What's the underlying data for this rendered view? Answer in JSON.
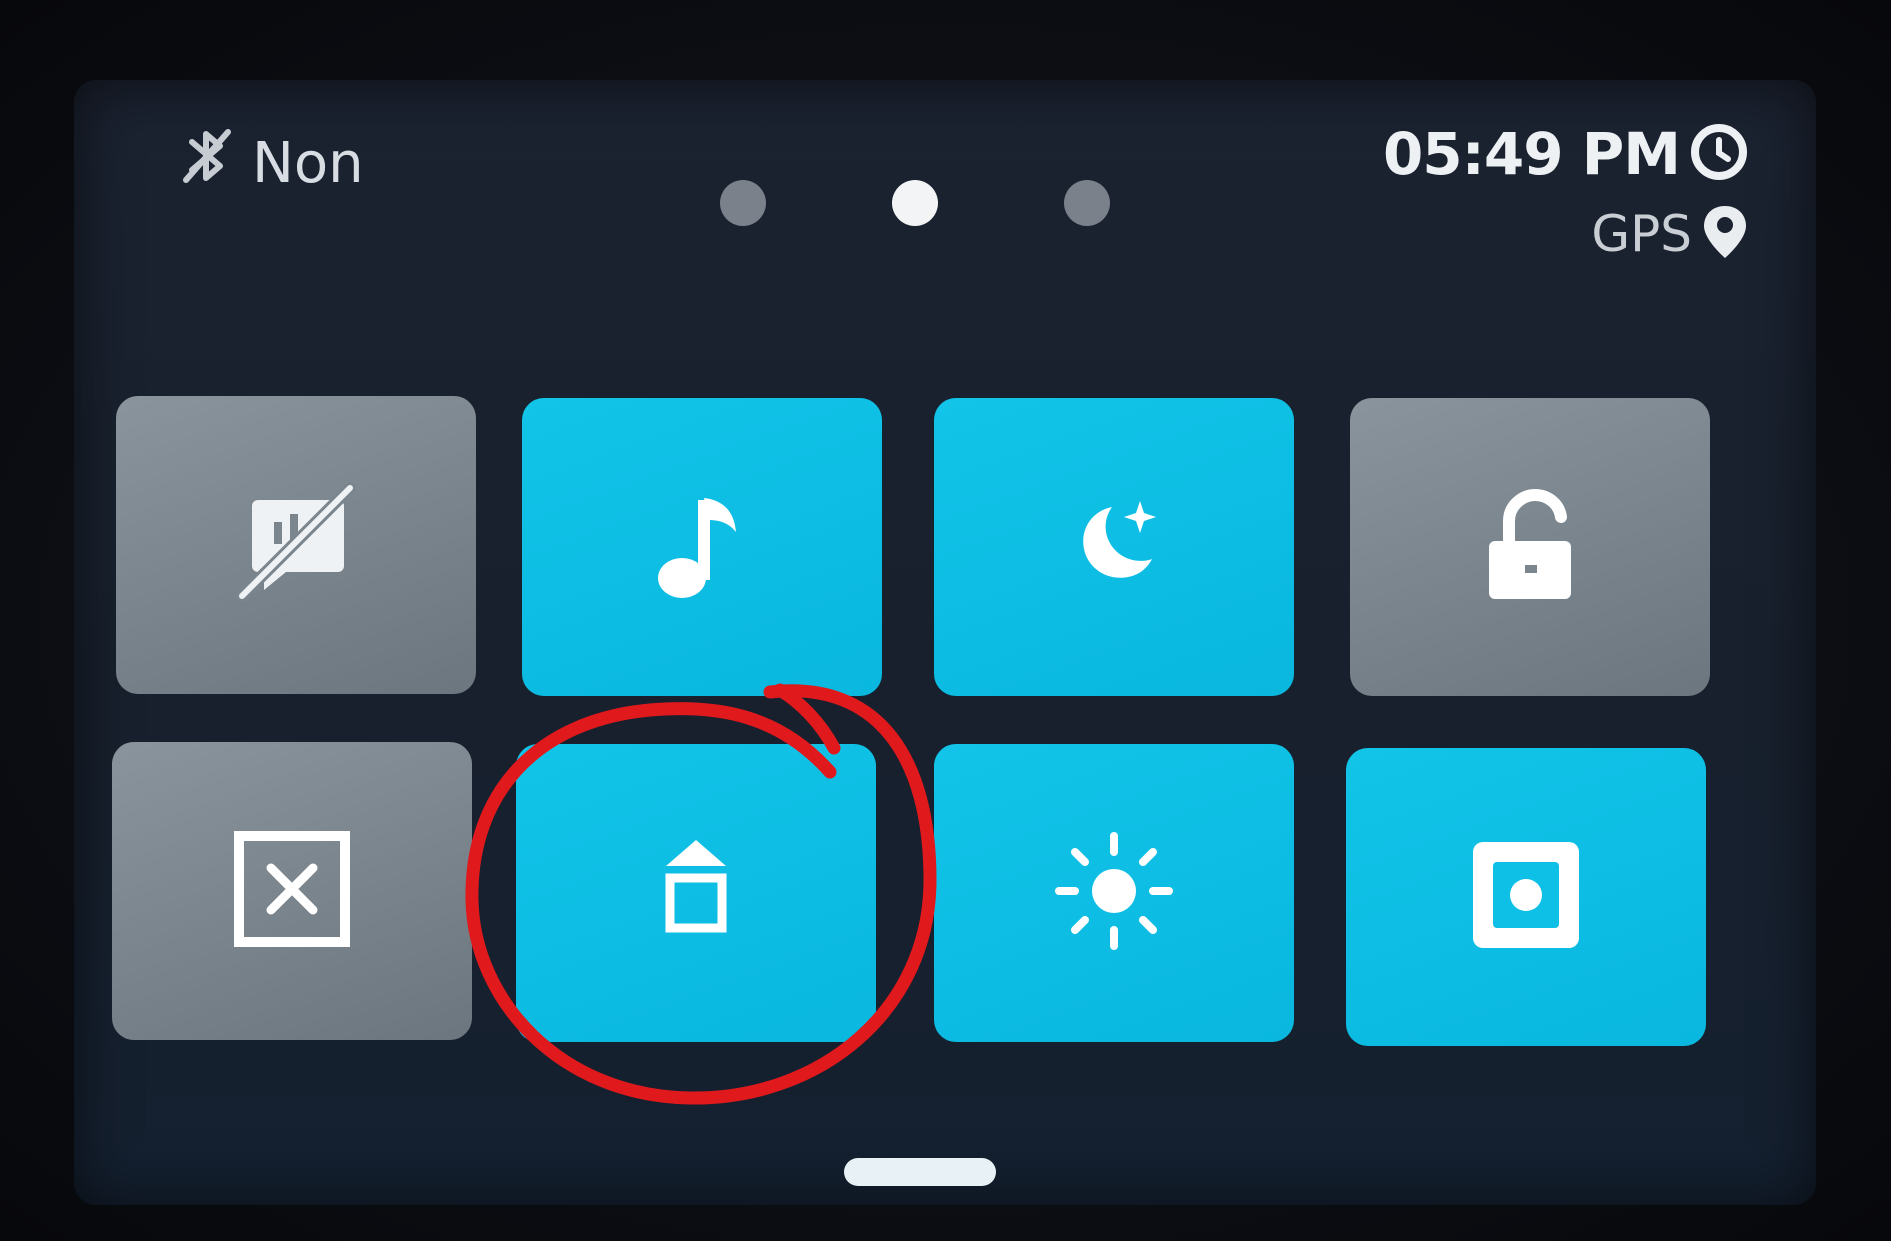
{
  "status": {
    "bluetooth_icon": "bluetooth-off-icon",
    "bluetooth_label": "Non",
    "time": "05:49 PM",
    "clock_icon": "clock-icon",
    "gps_label": "GPS",
    "gps_icon": "location-pin-icon"
  },
  "pager": {
    "pages": 3,
    "active_page": 2
  },
  "tiles": [
    {
      "name": "screen-stats-off",
      "icon": "stats-display-off-icon",
      "state": "off"
    },
    {
      "name": "sound",
      "icon": "music-note-icon",
      "state": "on"
    },
    {
      "name": "night-mode",
      "icon": "moon-star-icon",
      "state": "on"
    },
    {
      "name": "screen-lock",
      "icon": "unlock-icon",
      "state": "off"
    },
    {
      "name": "close-all",
      "icon": "box-x-icon",
      "state": "off"
    },
    {
      "name": "eject",
      "icon": "eject-icon",
      "state": "on"
    },
    {
      "name": "brightness",
      "icon": "sun-icon",
      "state": "on"
    },
    {
      "name": "record",
      "icon": "record-square-icon",
      "state": "on"
    }
  ],
  "colors": {
    "tile_on": "#0fc0e6",
    "tile_off": "#7b858d",
    "annotation": "#e0191c"
  },
  "annotation": {
    "type": "hand-drawn-circle",
    "target": "eject"
  }
}
